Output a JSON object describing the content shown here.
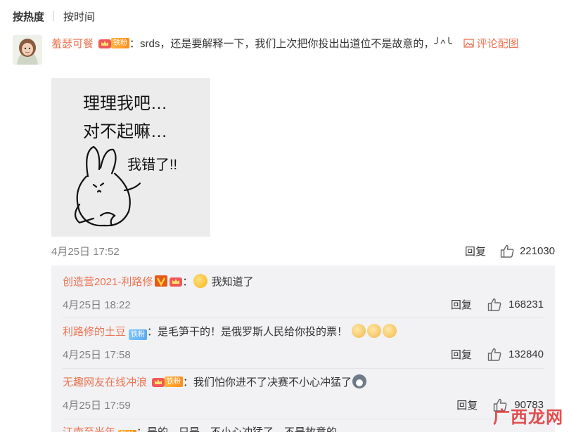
{
  "sort_tabs": {
    "hot": "按热度",
    "time": "按时间"
  },
  "main_comment": {
    "username": "羞瑟可餐",
    "fan_badge": "铁粉",
    "colon": "：",
    "text": "srds，还是要解释一下，我们上次把你投出出道位不是故意的，╯^╰",
    "comment_image_link": "评论配图",
    "image_text": {
      "line1": "理理我吧…",
      "line2": "对不起嘛…",
      "line3": "我错了!!"
    },
    "time": "4月25日 17:52",
    "reply_label": "回复",
    "likes": "221030"
  },
  "sub_comments": [
    {
      "username": "创造营2021-利路修",
      "text": "我知道了",
      "time": "4月25日 18:22",
      "reply_label": "回复",
      "likes": "168231",
      "emoji": "hushed-face"
    },
    {
      "username": "利路修的土豆",
      "fan_badge": "铁粉",
      "text": "是毛笋干的！是俄罗斯人民给你投的票！",
      "time": "4月25日 17:58",
      "reply_label": "回复",
      "likes": "132840",
      "emoji": "dog-face"
    },
    {
      "username": "无趣网友在线冲浪",
      "fan_badge": "铁粉",
      "text": "我们怕你进不了决赛不小心冲猛了",
      "time": "4月25日 17:59",
      "reply_label": "回复",
      "likes": "90783",
      "emoji": "husky"
    },
    {
      "username": "江南至光年",
      "fan_badge": "铁粉",
      "text": "是的，只是…不小心冲猛了，不是故意的"
    }
  ],
  "watermark": "广西龙网",
  "colors": {
    "accent": "#eb7350",
    "sub_bg": "#f2f2f5",
    "badge_orange": "#ff8c1a",
    "badge_blue": "#5aa9ef"
  }
}
